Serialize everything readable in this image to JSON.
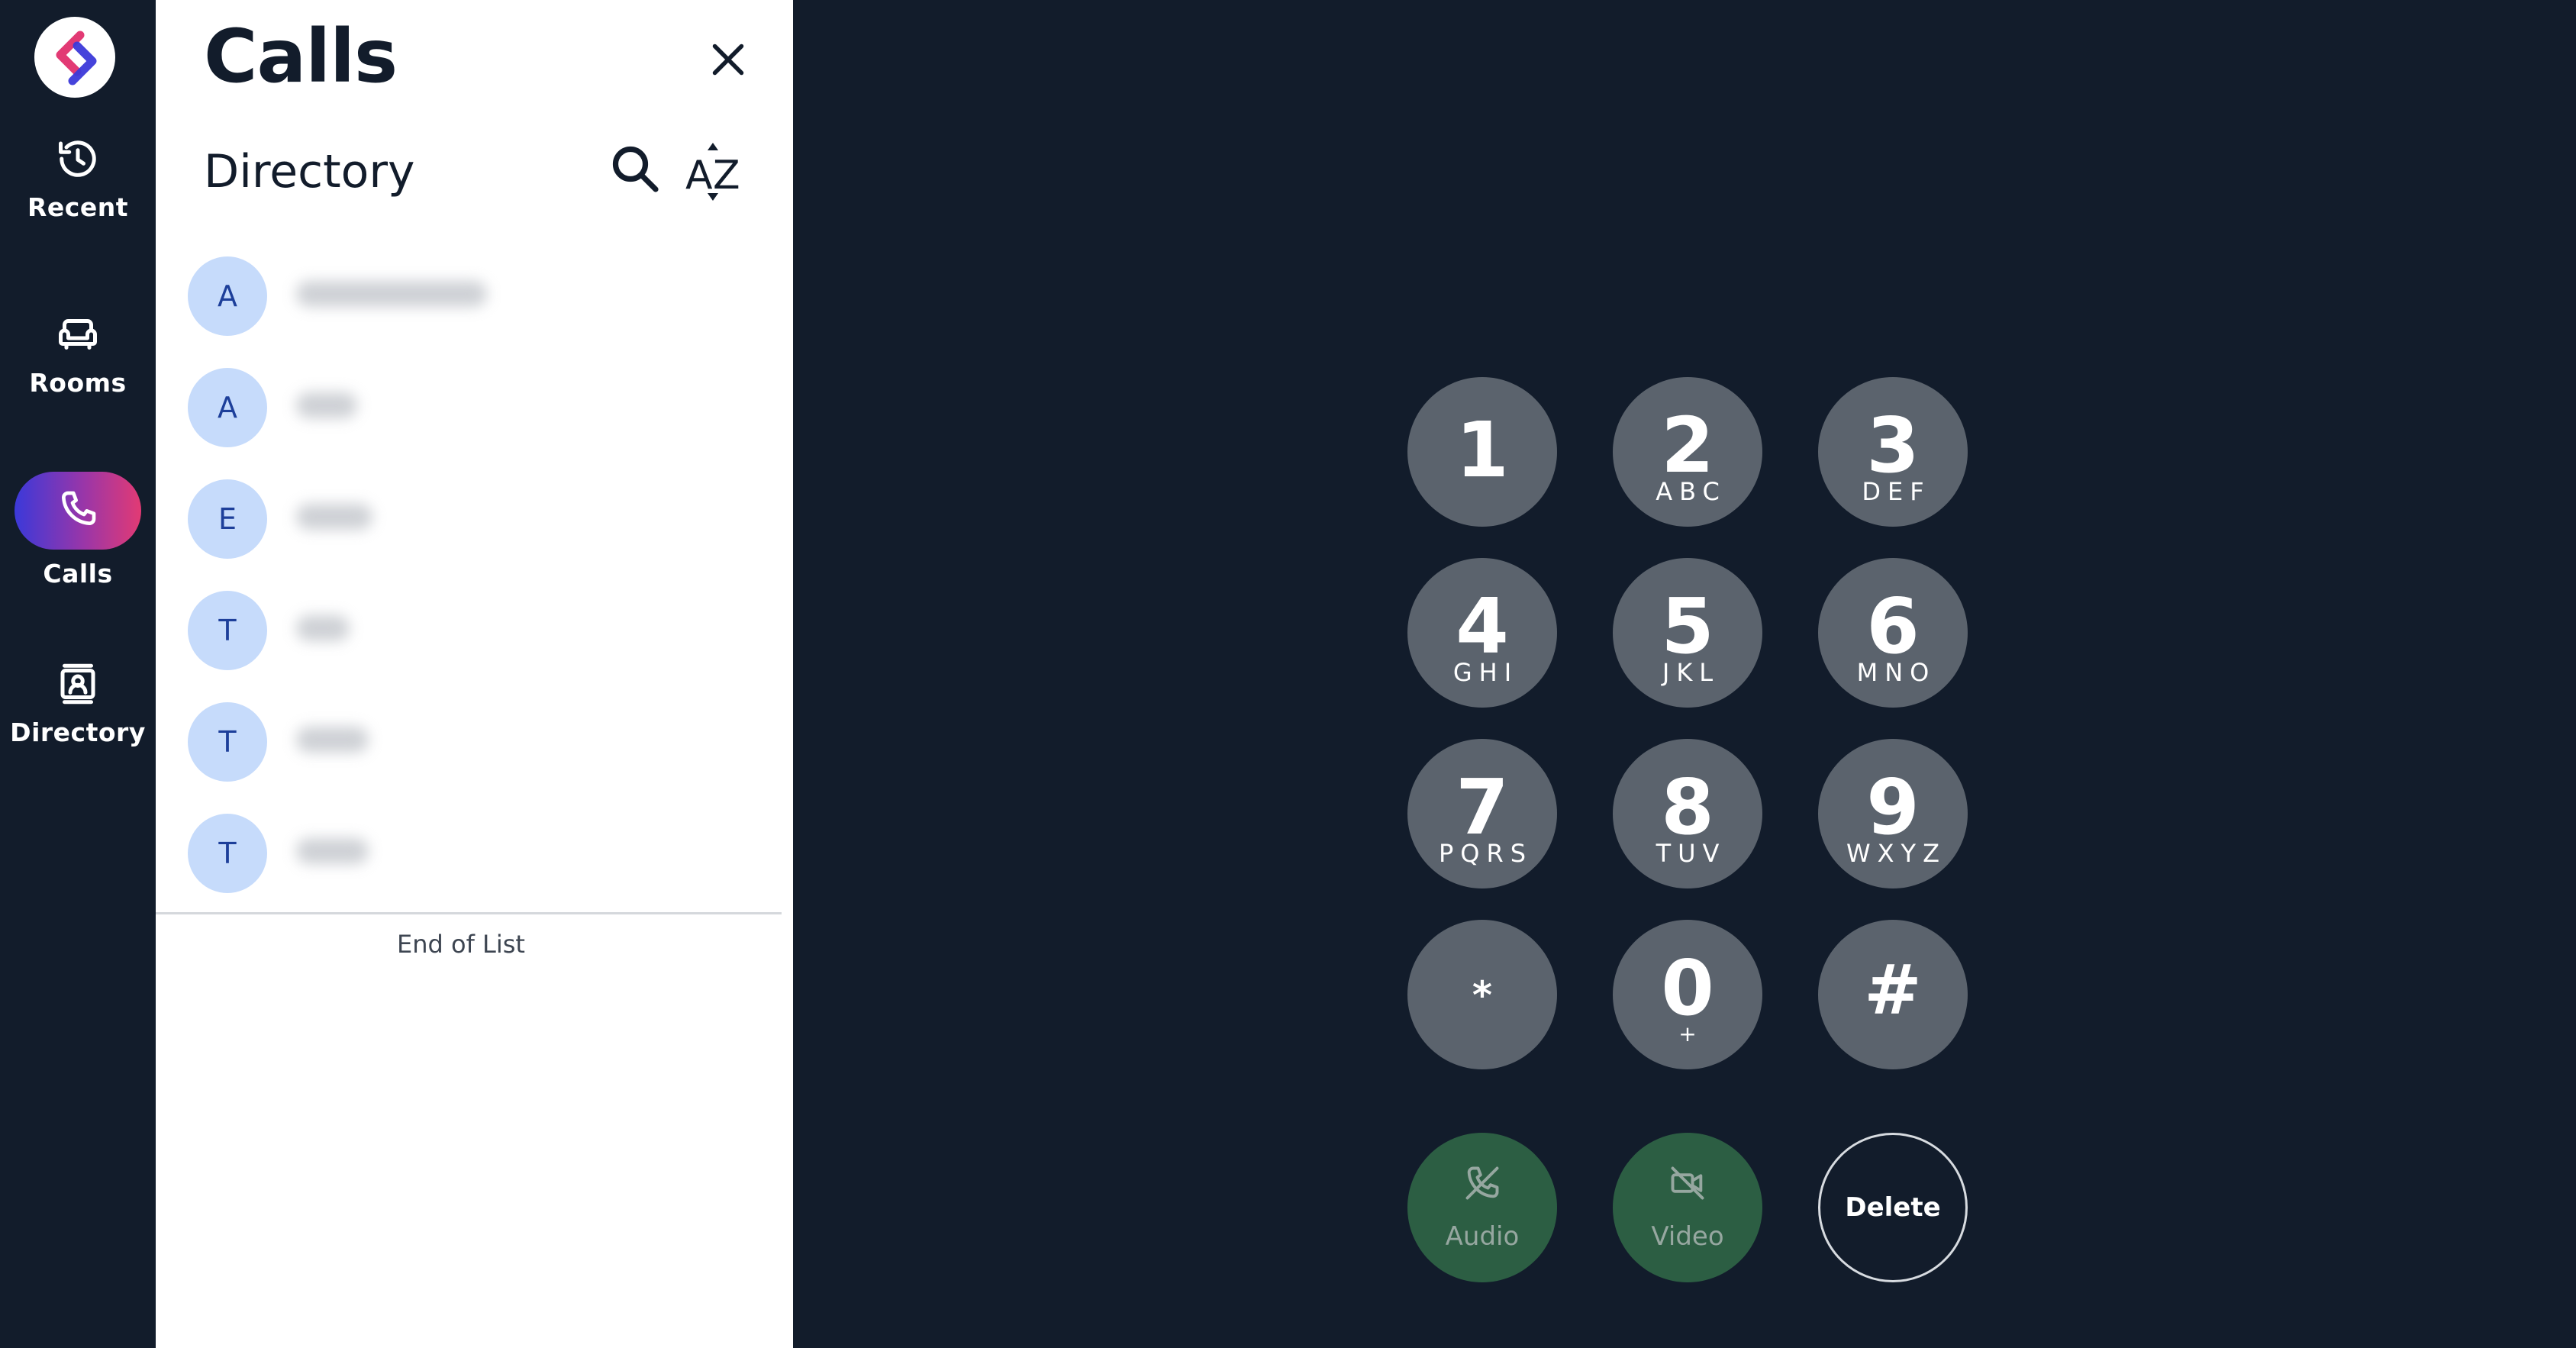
{
  "nav": {
    "logo_icon": "app-logo-icon",
    "items": [
      {
        "label": "Recent",
        "icon": "history-icon"
      },
      {
        "label": "Rooms",
        "icon": "couch-icon"
      },
      {
        "label": "Calls",
        "icon": "phone-icon",
        "active": true
      },
      {
        "label": "Directory",
        "icon": "contact-card-icon"
      }
    ]
  },
  "panel": {
    "title": "Calls",
    "section_title": "Directory",
    "close_icon": "close-icon",
    "search_icon": "search-icon",
    "sort_icon": "sort-az-icon",
    "contacts": [
      {
        "initial": "A"
      },
      {
        "initial": "A"
      },
      {
        "initial": "E"
      },
      {
        "initial": "T"
      },
      {
        "initial": "T"
      },
      {
        "initial": "T"
      }
    ],
    "end_of_list": "End of List"
  },
  "dialpad": {
    "keys": [
      {
        "digit": "1",
        "letters": ""
      },
      {
        "digit": "2",
        "letters": "ABC"
      },
      {
        "digit": "3",
        "letters": "DEF"
      },
      {
        "digit": "4",
        "letters": "GHI"
      },
      {
        "digit": "5",
        "letters": "JKL"
      },
      {
        "digit": "6",
        "letters": "MNO"
      },
      {
        "digit": "7",
        "letters": "PQRS"
      },
      {
        "digit": "8",
        "letters": "TUV"
      },
      {
        "digit": "9",
        "letters": "WXYZ"
      },
      {
        "digit": "*",
        "letters": ""
      },
      {
        "digit": "0",
        "letters": "+"
      },
      {
        "digit": "#",
        "letters": ""
      }
    ],
    "actions": {
      "audio": {
        "label": "Audio",
        "icon": "phone-off-icon"
      },
      "video": {
        "label": "Video",
        "icon": "video-off-icon"
      },
      "delete": {
        "label": "Delete"
      }
    }
  },
  "colors": {
    "background": "#121c2b",
    "panel": "#ffffff",
    "key": "#5b636d",
    "call_action": "#2c5e43",
    "avatar": "#c6dbfb",
    "accent_gradient": [
      "#3b39d9",
      "#e23a74"
    ]
  }
}
